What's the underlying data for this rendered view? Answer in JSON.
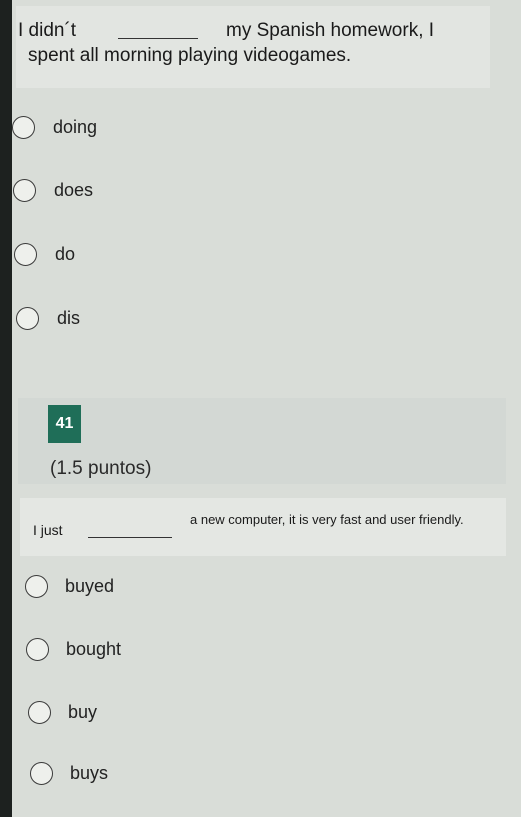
{
  "question1": {
    "text_part1": "I didn´t",
    "text_part2": "my Spanish homework, I",
    "text_part3": "spent all morning playing videogames.",
    "options": [
      "doing",
      "does",
      "do",
      "dis"
    ]
  },
  "question2": {
    "number": "41",
    "points": "(1.5 puntos)",
    "text_part1": "I just",
    "text_part2": "a new computer, it is very fast and user friendly.",
    "options": [
      "buyed",
      "bought",
      "buy",
      "buys"
    ]
  }
}
